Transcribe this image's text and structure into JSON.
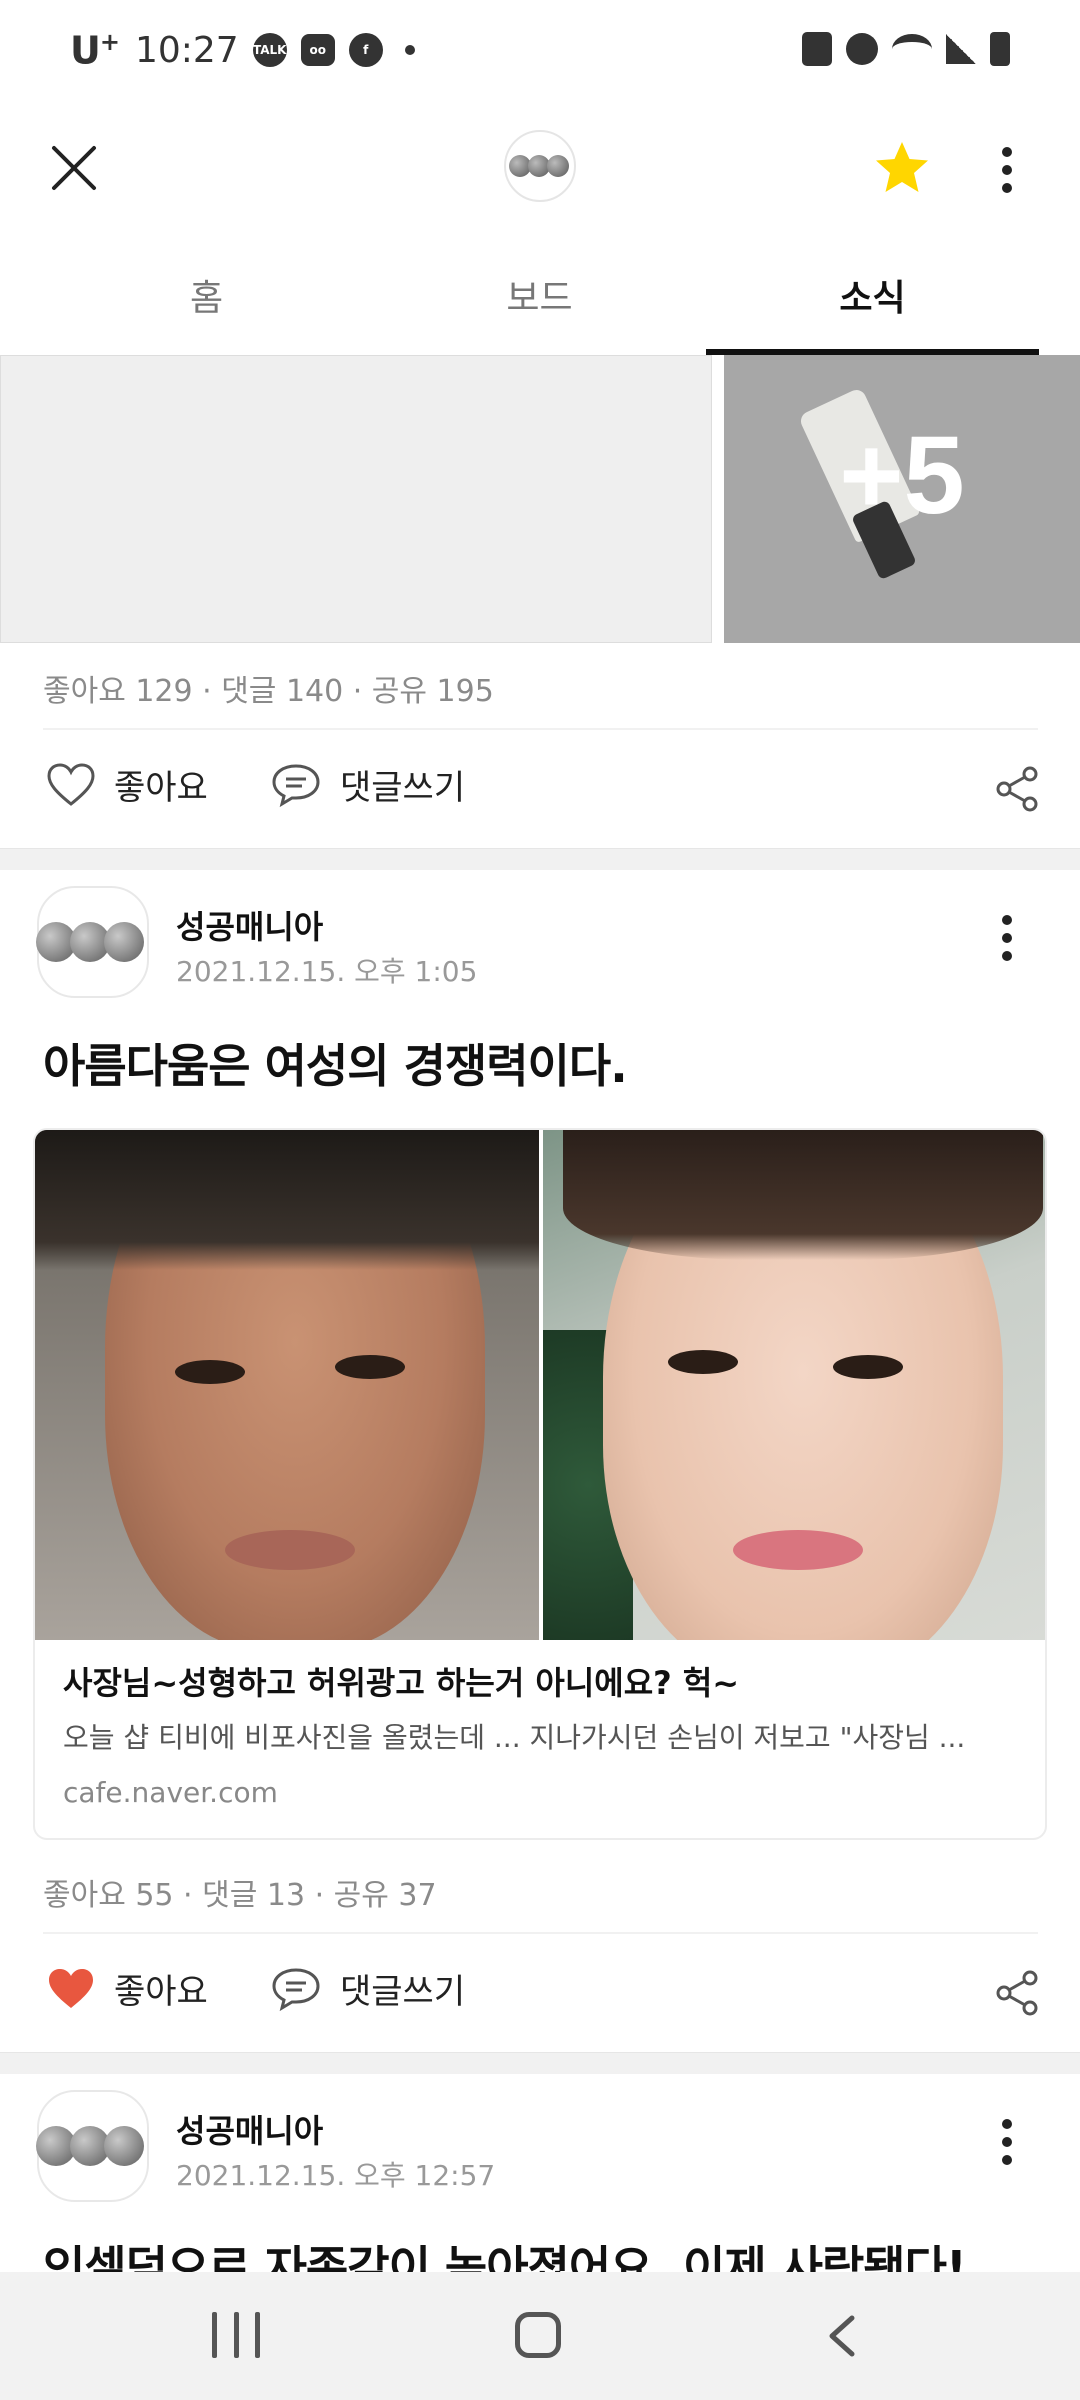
{
  "status_bar": {
    "carrier": "U",
    "carrier_sup": "+",
    "time": "10:27",
    "icons": [
      "talk-icon",
      "voicemail-icon",
      "facebook-icon",
      "notification-dot",
      "recycle-icon",
      "alarm-icon",
      "wifi-icon",
      "signal-icon",
      "battery-icon"
    ]
  },
  "header": {
    "close_icon": "close-icon",
    "logo": "band-logo",
    "favorite_icon": "star-icon",
    "favorite_color": "#FFD600",
    "more_icon": "more-vertical-icon"
  },
  "tabs": [
    {
      "label": "홈",
      "active": false
    },
    {
      "label": "보드",
      "active": false
    },
    {
      "label": "소식",
      "active": true
    }
  ],
  "post1": {
    "more_images": "+5",
    "stats": "좋아요 129 · 댓글 140 · 공유 195",
    "like_label": "좋아요",
    "liked": false,
    "comment_label": "댓글쓰기"
  },
  "post2": {
    "author": "성공매니아",
    "date": "2021.12.15. 오후 1:05",
    "title": "아름다움은 여성의 경쟁력이다.",
    "link": {
      "title": "사장님~성형하고  허위광고 하는거 아니에요? 헉~",
      "description": "오늘 샵 티비에 비포사진을 올렸는데 ... 지나가시던 손님이 저보고 \"사장님 ...",
      "domain": "cafe.naver.com"
    },
    "stats": "좋아요 55 · 댓글 13 · 공유 37",
    "like_label": "좋아요",
    "liked": true,
    "like_color": "#E8573F",
    "comment_label": "댓글쓰기"
  },
  "post3": {
    "author": "성공매니아",
    "date": "2021.12.15. 오후 12:57",
    "title": "인셀덤으로 자존감이 높아졌어요. 이제 사람됐다!"
  },
  "nav": {
    "recents_icon": "recents-icon",
    "home_icon": "home-icon",
    "back_icon": "back-icon"
  }
}
